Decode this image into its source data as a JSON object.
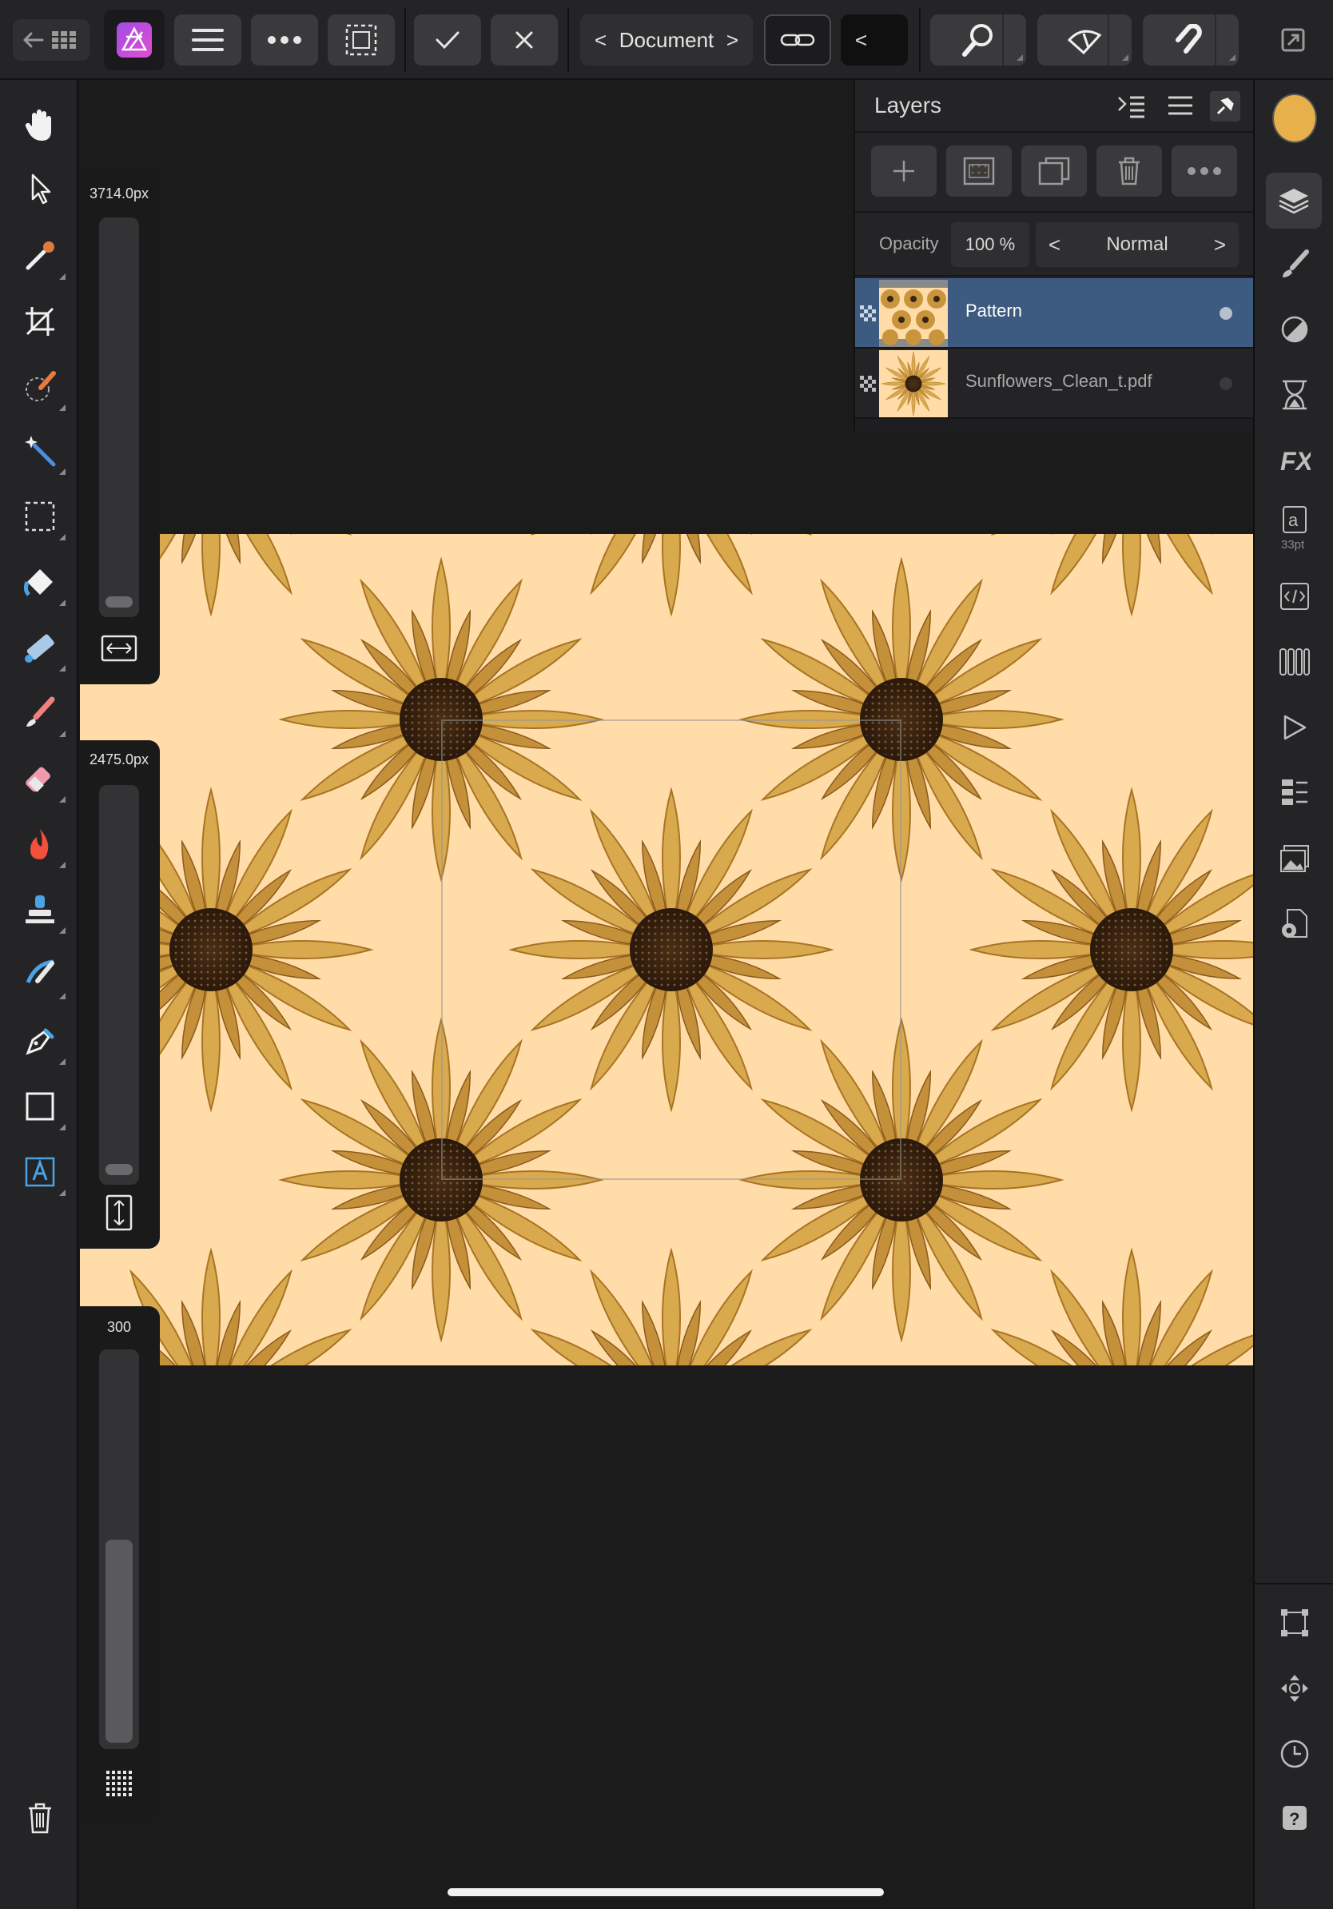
{
  "toolbar": {
    "document_label": "Document",
    "document_prev": "<",
    "document_next": ">",
    "extra_prev": "<"
  },
  "left_tools": [
    {
      "name": "hand-tool-icon"
    },
    {
      "name": "move-tool-icon"
    },
    {
      "name": "color-picker-tool-icon"
    },
    {
      "name": "crop-tool-icon"
    },
    {
      "name": "selection-brush-tool-icon"
    },
    {
      "name": "flood-select-tool-icon"
    },
    {
      "name": "marquee-tool-icon"
    },
    {
      "name": "flood-fill-tool-icon"
    },
    {
      "name": "gradient-tool-icon"
    },
    {
      "name": "paint-brush-tool-icon"
    },
    {
      "name": "erase-brush-tool-icon"
    },
    {
      "name": "dodge-brush-tool-icon"
    },
    {
      "name": "clone-brush-tool-icon"
    },
    {
      "name": "smudge-brush-tool-icon"
    },
    {
      "name": "pen-tool-icon"
    },
    {
      "name": "rectangle-tool-icon"
    },
    {
      "name": "artistic-text-tool-icon"
    },
    {
      "name": "trash-icon"
    }
  ],
  "sliders": {
    "width_value": "3714.0px",
    "height_value": "2475.0px",
    "third_value": "300"
  },
  "layers_panel": {
    "title": "Layers",
    "opacity_label": "Opacity",
    "opacity_value": "100 %",
    "blend_mode": "Normal",
    "blend_prev": "<",
    "blend_next": ">",
    "layers": [
      {
        "name": "Pattern",
        "selected": true
      },
      {
        "name": "Sunflowers_Clean_t.pdf",
        "selected": false
      }
    ]
  },
  "right_studio": {
    "color_swatch": "#e8b04a",
    "text_style_size": "33pt"
  },
  "colors": {
    "accent_selected": "#3d5a80",
    "canvas_bg": "#ffdca8",
    "flower_center": "#3a2412",
    "petal": "#c9953c"
  }
}
